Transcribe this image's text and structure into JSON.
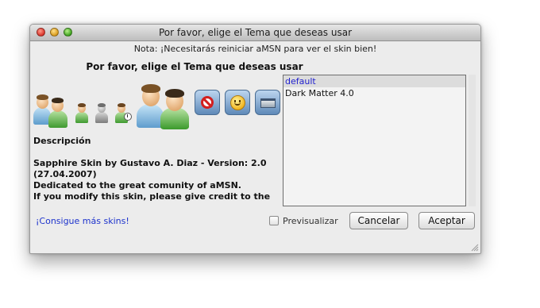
{
  "window": {
    "title": "Por favor, elige el Tema que deseas usar",
    "note": "Nota: ¡Necesitarás reiniciar aMSN para ver el skin bien!",
    "heading": "Por favor, elige el Tema que deseas usar"
  },
  "preview_icons": [
    "contacts-icon",
    "online-user-icon",
    "offline-user-icon",
    "away-user-icon",
    "large-contacts-icon",
    "blocked-icon",
    "smiley-icon",
    "toolbar-icon"
  ],
  "description": {
    "label": "Descripción",
    "lines": [
      "Sapphire Skin by Gustavo A. Diaz - Version: 2.0",
      "(27.04.2007)",
      "Dedicated to the great comunity of aMSN.",
      "If you modify this skin, please give credit to the"
    ]
  },
  "skins": {
    "items": [
      "default",
      "Dark Matter 4.0"
    ],
    "selected": "default"
  },
  "footer": {
    "link": "¡Consigue más skins!",
    "preview_label": "Previsualizar",
    "preview_checked": false,
    "cancel_label": "Cancelar",
    "accept_label": "Aceptar"
  },
  "colors": {
    "link": "#1d33cc",
    "selected_text": "#1f1fcf"
  }
}
